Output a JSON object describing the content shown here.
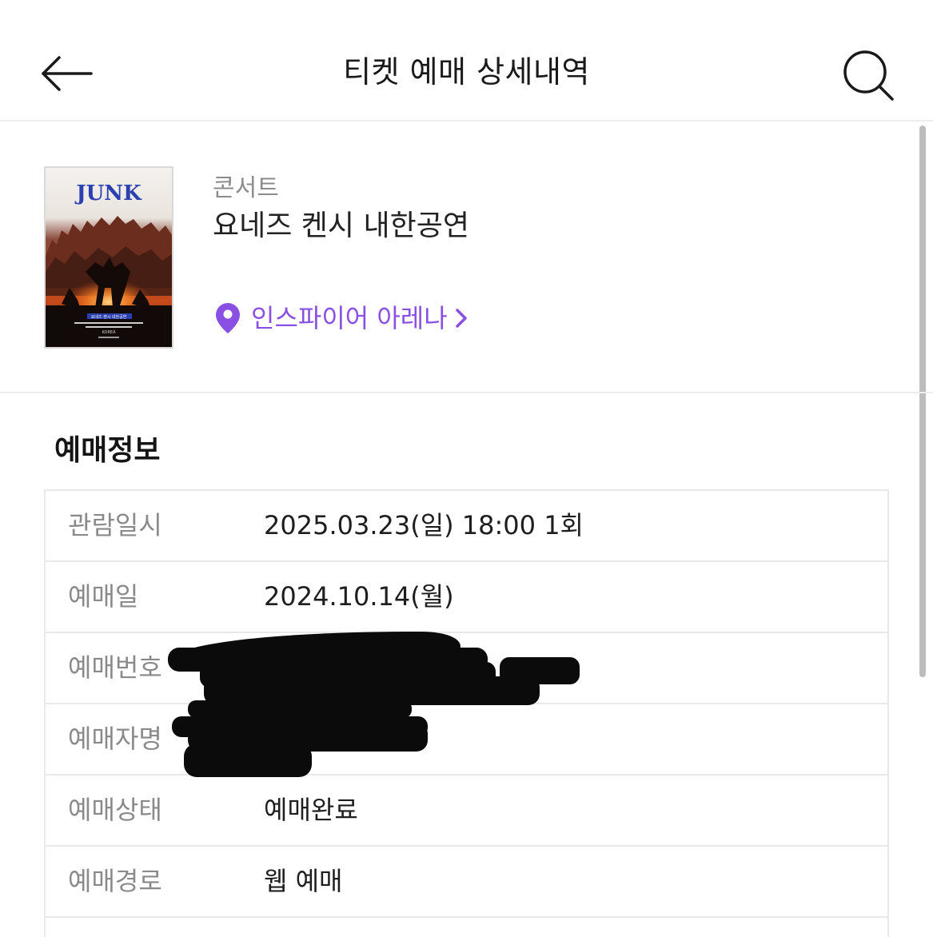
{
  "header": {
    "title": "티켓 예매 상세내역",
    "back_icon": "arrow-left-icon",
    "search_icon": "search-icon"
  },
  "event": {
    "category": "콘서트",
    "title": "요네즈 켄시 내한공연",
    "venue": "인스파이어 아레나",
    "venue_icon": "location-pin-icon",
    "accent_color": "#8a4fe3",
    "poster": {
      "logo_text": "JUNK",
      "subtitle": "요네즈 켄시 내한공연",
      "country": "KOREA"
    }
  },
  "booking": {
    "section_title": "예매정보",
    "rows": [
      {
        "label": "관람일시",
        "value": "2025.03.23(일) 18:00 1회"
      },
      {
        "label": "예매일",
        "value": "2024.10.14(월)"
      },
      {
        "label": "예매번호",
        "value": ""
      },
      {
        "label": "예매자명",
        "value": ""
      },
      {
        "label": "예매상태",
        "value": "예매완료"
      },
      {
        "label": "예매경로",
        "value": "웹 예매"
      }
    ]
  }
}
